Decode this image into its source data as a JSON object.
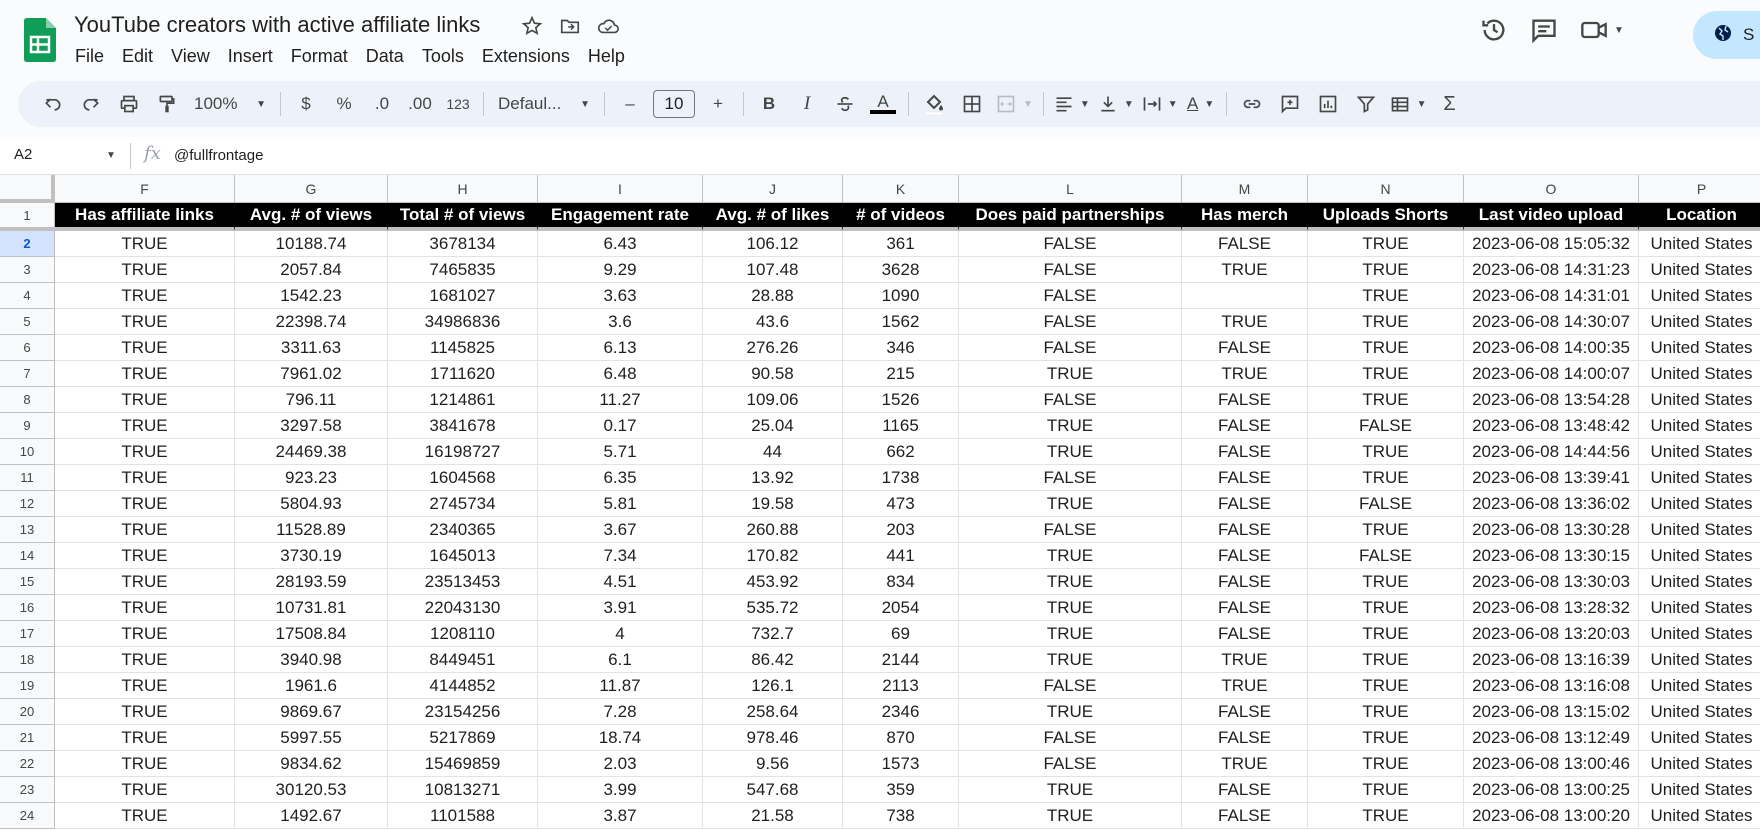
{
  "app": {
    "title": "YouTube creators with active affiliate links",
    "menu": [
      "File",
      "Edit",
      "View",
      "Insert",
      "Format",
      "Data",
      "Tools",
      "Extensions",
      "Help"
    ],
    "share_label": "S"
  },
  "toolbar": {
    "zoom": "100%",
    "currency": "$",
    "percent": "%",
    "decrease_decimal": ".0",
    "increase_decimal": ".00",
    "number_format": "123",
    "font": "Defaul...",
    "font_size": "10",
    "minus": "–",
    "plus": "+",
    "bold": "B",
    "italic": "I",
    "text_color_label": "A",
    "text_rotation_label": "A",
    "functions": "Σ"
  },
  "formula_bar": {
    "cell_ref": "A2",
    "fx": "fx",
    "value": "@fullfrontage"
  },
  "grid": {
    "column_letters": [
      "F",
      "G",
      "H",
      "I",
      "J",
      "K",
      "L",
      "M",
      "N",
      "O",
      "P"
    ],
    "row_numbers": [
      "1",
      "2",
      "3",
      "4",
      "5",
      "6",
      "7",
      "8",
      "9",
      "10",
      "11",
      "12",
      "13",
      "14",
      "15",
      "16",
      "17",
      "18",
      "19",
      "20",
      "21",
      "22",
      "23",
      "24"
    ],
    "header": [
      "Has affiliate links",
      "Avg. # of views",
      "Total # of views",
      "Engagement rate",
      "Avg. # of likes",
      "# of videos",
      "Does paid partnerships",
      "Has merch",
      "Uploads Shorts",
      "Last video upload",
      "Location"
    ],
    "rows": [
      [
        "TRUE",
        "10188.74",
        "3678134",
        "6.43",
        "106.12",
        "361",
        "FALSE",
        "FALSE",
        "TRUE",
        "2023-06-08 15:05:32",
        "United States"
      ],
      [
        "TRUE",
        "2057.84",
        "7465835",
        "9.29",
        "107.48",
        "3628",
        "FALSE",
        "TRUE",
        "TRUE",
        "2023-06-08 14:31:23",
        "United States"
      ],
      [
        "TRUE",
        "1542.23",
        "1681027",
        "3.63",
        "28.88",
        "1090",
        "FALSE",
        "",
        "TRUE",
        "2023-06-08 14:31:01",
        "United States"
      ],
      [
        "TRUE",
        "22398.74",
        "34986836",
        "3.6",
        "43.6",
        "1562",
        "FALSE",
        "TRUE",
        "TRUE",
        "2023-06-08 14:30:07",
        "United States"
      ],
      [
        "TRUE",
        "3311.63",
        "1145825",
        "6.13",
        "276.26",
        "346",
        "FALSE",
        "FALSE",
        "TRUE",
        "2023-06-08 14:00:35",
        "United States"
      ],
      [
        "TRUE",
        "7961.02",
        "1711620",
        "6.48",
        "90.58",
        "215",
        "TRUE",
        "TRUE",
        "TRUE",
        "2023-06-08 14:00:07",
        "United States"
      ],
      [
        "TRUE",
        "796.11",
        "1214861",
        "11.27",
        "109.06",
        "1526",
        "FALSE",
        "FALSE",
        "TRUE",
        "2023-06-08 13:54:28",
        "United States"
      ],
      [
        "TRUE",
        "3297.58",
        "3841678",
        "0.17",
        "25.04",
        "1165",
        "TRUE",
        "FALSE",
        "FALSE",
        "2023-06-08 13:48:42",
        "United States"
      ],
      [
        "TRUE",
        "24469.38",
        "16198727",
        "5.71",
        "44",
        "662",
        "TRUE",
        "FALSE",
        "TRUE",
        "2023-06-08 14:44:56",
        "United States"
      ],
      [
        "TRUE",
        "923.23",
        "1604568",
        "6.35",
        "13.92",
        "1738",
        "FALSE",
        "FALSE",
        "TRUE",
        "2023-06-08 13:39:41",
        "United States"
      ],
      [
        "TRUE",
        "5804.93",
        "2745734",
        "5.81",
        "19.58",
        "473",
        "TRUE",
        "FALSE",
        "FALSE",
        "2023-06-08 13:36:02",
        "United States"
      ],
      [
        "TRUE",
        "11528.89",
        "2340365",
        "3.67",
        "260.88",
        "203",
        "FALSE",
        "FALSE",
        "TRUE",
        "2023-06-08 13:30:28",
        "United States"
      ],
      [
        "TRUE",
        "3730.19",
        "1645013",
        "7.34",
        "170.82",
        "441",
        "TRUE",
        "FALSE",
        "FALSE",
        "2023-06-08 13:30:15",
        "United States"
      ],
      [
        "TRUE",
        "28193.59",
        "23513453",
        "4.51",
        "453.92",
        "834",
        "TRUE",
        "FALSE",
        "TRUE",
        "2023-06-08 13:30:03",
        "United States"
      ],
      [
        "TRUE",
        "10731.81",
        "22043130",
        "3.91",
        "535.72",
        "2054",
        "TRUE",
        "FALSE",
        "TRUE",
        "2023-06-08 13:28:32",
        "United States"
      ],
      [
        "TRUE",
        "17508.84",
        "1208110",
        "4",
        "732.7",
        "69",
        "TRUE",
        "FALSE",
        "TRUE",
        "2023-06-08 13:20:03",
        "United States"
      ],
      [
        "TRUE",
        "3940.98",
        "8449451",
        "6.1",
        "86.42",
        "2144",
        "TRUE",
        "TRUE",
        "TRUE",
        "2023-06-08 13:16:39",
        "United States"
      ],
      [
        "TRUE",
        "1961.6",
        "4144852",
        "11.87",
        "126.1",
        "2113",
        "FALSE",
        "TRUE",
        "TRUE",
        "2023-06-08 13:16:08",
        "United States"
      ],
      [
        "TRUE",
        "9869.67",
        "23154256",
        "7.28",
        "258.64",
        "2346",
        "TRUE",
        "FALSE",
        "TRUE",
        "2023-06-08 13:15:02",
        "United States"
      ],
      [
        "TRUE",
        "5997.55",
        "5217869",
        "18.74",
        "978.46",
        "870",
        "FALSE",
        "FALSE",
        "TRUE",
        "2023-06-08 13:12:49",
        "United States"
      ],
      [
        "TRUE",
        "9834.62",
        "15469859",
        "2.03",
        "9.56",
        "1573",
        "FALSE",
        "TRUE",
        "TRUE",
        "2023-06-08 13:00:46",
        "United States"
      ],
      [
        "TRUE",
        "30120.53",
        "10813271",
        "3.99",
        "547.68",
        "359",
        "TRUE",
        "FALSE",
        "TRUE",
        "2023-06-08 13:00:25",
        "United States"
      ],
      [
        "TRUE",
        "1492.67",
        "1101588",
        "3.87",
        "21.58",
        "738",
        "TRUE",
        "FALSE",
        "TRUE",
        "2023-06-08 13:00:20",
        "United States"
      ]
    ],
    "selected_row": "2"
  },
  "colors": {
    "accent": "#0b57d0",
    "header_bg": "#000000",
    "share_bg": "#c2e7ff",
    "logo_green": "#0f9d58"
  }
}
